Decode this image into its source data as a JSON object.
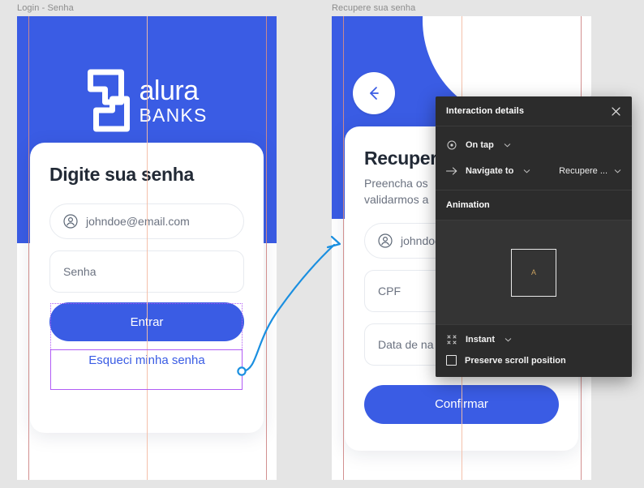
{
  "canvas": {
    "background": "#e5e5e5",
    "brand_blue": "#3a5ce4",
    "selection_purple": "#b15cf5",
    "connector_blue": "#1a8fe0",
    "guide_color": "#f3bda6"
  },
  "frames": [
    {
      "id": "login-senha",
      "title": "Login - Senha",
      "logo": {
        "name": "alura",
        "sub": "BANKS"
      },
      "card": {
        "title": "Digite sua senha",
        "fields": [
          {
            "icon": "user-icon",
            "value": "johndoe@email.com",
            "shape": "pill"
          },
          {
            "icon": "",
            "value": "Senha",
            "shape": "rounded"
          }
        ],
        "primary_button": "Entrar",
        "link_button": "Esqueci minha senha"
      }
    },
    {
      "id": "recupere-sua-senha",
      "title": "Recupere sua senha",
      "back_icon": "arrow-left-icon",
      "card": {
        "title": "Recupere",
        "subtitle_line1": "Preencha os",
        "subtitle_line2": "validarmos a",
        "fields": [
          {
            "icon": "user-icon",
            "value": "johndoe",
            "shape": "pill"
          },
          {
            "icon": "",
            "value": "CPF",
            "shape": "rounded"
          },
          {
            "icon": "",
            "value": "Data de na",
            "shape": "rounded"
          }
        ],
        "primary_button": "Confirmar"
      }
    }
  ],
  "panel": {
    "title": "Interaction details",
    "close_icon": "close-icon",
    "trigger": {
      "icon": "tap-target-icon",
      "label": "On tap",
      "caret": "chevron-down-icon"
    },
    "action": {
      "icon": "arrow-right-icon",
      "label": "Navigate to",
      "caret": "chevron-down-icon",
      "destination": "Recupere ...",
      "destination_caret": "chevron-down-icon"
    },
    "animation_section": "Animation",
    "animation_preview_glyph": "A",
    "animation": {
      "icon": "instant-icon",
      "label": "Instant",
      "caret": "chevron-down-icon"
    },
    "preserve_scroll": {
      "label": "Preserve scroll position",
      "checked": false
    }
  }
}
